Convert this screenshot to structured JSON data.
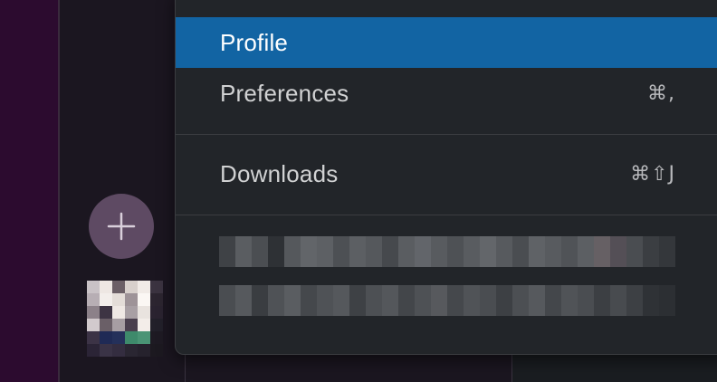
{
  "menu": {
    "items": [
      {
        "label": "Profile",
        "shortcut": "",
        "highlighted": true
      },
      {
        "label": "Preferences",
        "shortcut": "⌘,"
      },
      {
        "label": "Downloads",
        "shortcut": "⌘⇧J"
      }
    ]
  },
  "sidebar": {
    "add_button_icon": "plus-icon"
  },
  "colors": {
    "highlight": "#1264a3",
    "menu_background": "#222529",
    "workspace_rail": "#2c0b2f"
  }
}
